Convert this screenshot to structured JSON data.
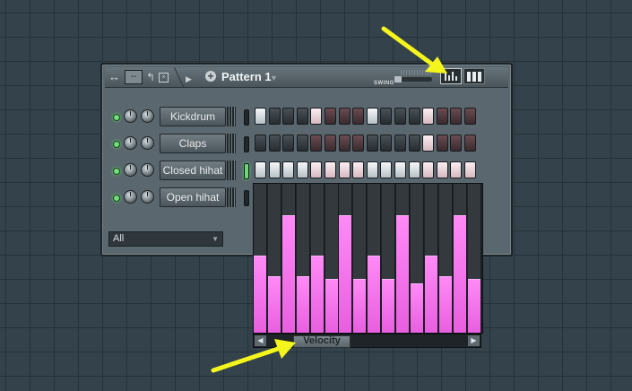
{
  "titlebar": {
    "move_icon": "move-icon",
    "pattern_name": "Pattern 1",
    "swing_label": "SWING"
  },
  "channels": [
    {
      "name": "Kickdrum",
      "selected": false,
      "steps": [
        "on",
        "off-dark",
        "off-dark",
        "off-dark",
        "on-pink",
        "off-red",
        "off-red",
        "off-red",
        "on",
        "off-dark",
        "off-dark",
        "off-dark",
        "on-pink",
        "off-red",
        "off-red",
        "off-red"
      ]
    },
    {
      "name": "Claps",
      "selected": false,
      "steps": [
        "off-dark",
        "off-dark",
        "off-dark",
        "off-dark",
        "off-red",
        "off-red",
        "off-red",
        "off-red",
        "off-dark",
        "off-dark",
        "off-dark",
        "off-dark",
        "on-pink",
        "off-red",
        "off-red",
        "off-red"
      ]
    },
    {
      "name": "Closed hihat",
      "selected": true,
      "steps": [
        "on",
        "on",
        "on",
        "on",
        "on-pink",
        "on-pink",
        "on-pink",
        "on-pink",
        "on",
        "on",
        "on",
        "on",
        "on-pink",
        "on-pink",
        "on-pink",
        "on-pink"
      ]
    },
    {
      "name": "Open hihat",
      "selected": false,
      "steps": []
    }
  ],
  "filter": {
    "value": "All"
  },
  "graph": {
    "tab_label": "Velocity",
    "velocity_levels": [
      0.52,
      0.38,
      0.79,
      0.38,
      0.52,
      0.36,
      0.79,
      0.36,
      0.52,
      0.36,
      0.79,
      0.33,
      0.52,
      0.38,
      0.79,
      0.36
    ]
  },
  "colors": {
    "velocity_bar": "#ff7af4",
    "annotation_arrow": "#f5f51e",
    "selected_led": "#6fd57a"
  }
}
